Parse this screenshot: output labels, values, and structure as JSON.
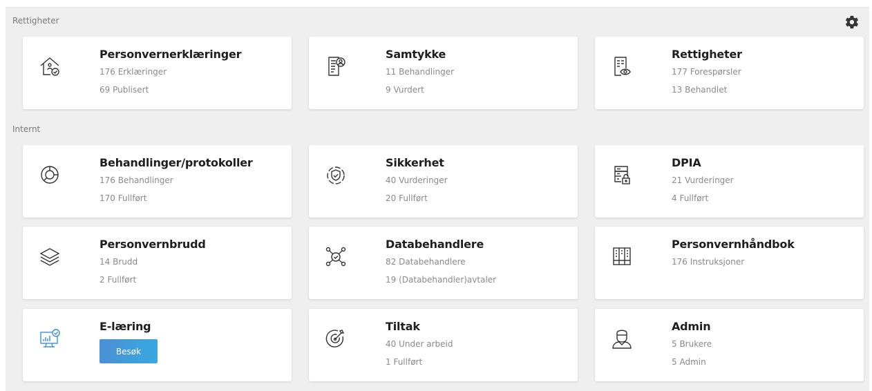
{
  "sections": {
    "rights_label": "Rettigheter",
    "internal_label": "Internt"
  },
  "icons": {
    "settings": "gear-icon"
  },
  "colors": {
    "background": "#efefef",
    "card": "#ffffff",
    "button_start": "#4a90d6",
    "button_end": "#38a8e0",
    "elearning_icon": "#3a8fd8"
  },
  "cards": [
    {
      "title": "Personvernerklæringer",
      "line1": "176 Erklæringer",
      "line2": "69 Publisert",
      "icon": "house-check-icon"
    },
    {
      "title": "Samtykke",
      "line1": "11 Behandlinger",
      "line2": "9 Vurdert",
      "icon": "document-user-icon"
    },
    {
      "title": "Rettigheter",
      "line1": "177 Forespørsler",
      "line2": "13 Behandlet",
      "icon": "document-eye-icon"
    },
    {
      "title": "Behandlinger/protokoller",
      "line1": "176 Behandlinger",
      "line2": "170 Fullført",
      "icon": "donut-chart-icon"
    },
    {
      "title": "Sikkerhet",
      "line1": "40 Vurderinger",
      "line2": "20 Fullført",
      "icon": "shield-check-icon"
    },
    {
      "title": "DPIA",
      "line1": "21 Vurderinger",
      "line2": "4 Fullført",
      "icon": "server-lock-icon"
    },
    {
      "title": "Personvernbrudd",
      "line1": "14 Brudd",
      "line2": "2 Fullført",
      "icon": "layers-icon"
    },
    {
      "title": "Databehandlere",
      "line1": "82 Databehandlere",
      "line2": "19 (Databehandler)avtaler",
      "icon": "network-check-icon"
    },
    {
      "title": "Personvernhåndbok",
      "line1": "176 Instruksjoner",
      "line2": "",
      "icon": "book-icon"
    },
    {
      "title": "E-læring",
      "button": "Besøk",
      "icon": "monitor-chart-icon"
    },
    {
      "title": "Tiltak",
      "line1": "40 Under arbeid",
      "line2": "1 Fullført",
      "icon": "target-icon"
    },
    {
      "title": "Admin",
      "line1": "5 Brukere",
      "line2": "5 Admin",
      "icon": "user-icon"
    }
  ]
}
